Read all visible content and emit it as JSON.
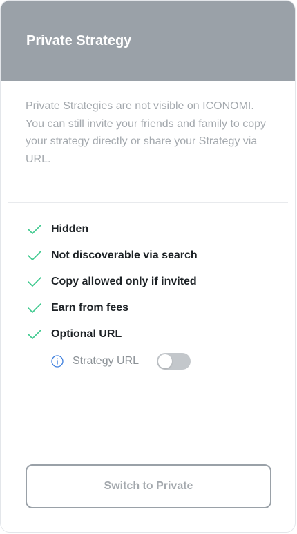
{
  "header": {
    "title": "Private Strategy"
  },
  "description": "Private Strategies are not visible on ICONOMI. You can still invite your friends and family to copy your strategy directly or share your Strategy via URL.",
  "features": [
    {
      "label": "Hidden",
      "icon": "check-icon"
    },
    {
      "label": "Not discoverable via search",
      "icon": "check-icon"
    },
    {
      "label": "Copy allowed only if invited",
      "icon": "check-icon"
    },
    {
      "label": "Earn from fees",
      "icon": "check-icon"
    },
    {
      "label": "Optional URL",
      "icon": "check-icon"
    }
  ],
  "strategy_url": {
    "label": "Strategy URL",
    "icon": "info-icon",
    "toggle_on": false
  },
  "actions": {
    "switch_label": "Switch to Private"
  },
  "colors": {
    "header_bg": "#9aa1a8",
    "check": "#3ec98e",
    "info": "#3b7ddd",
    "muted_text": "#a4a9ae",
    "toggle_off": "#c3c7cb"
  }
}
